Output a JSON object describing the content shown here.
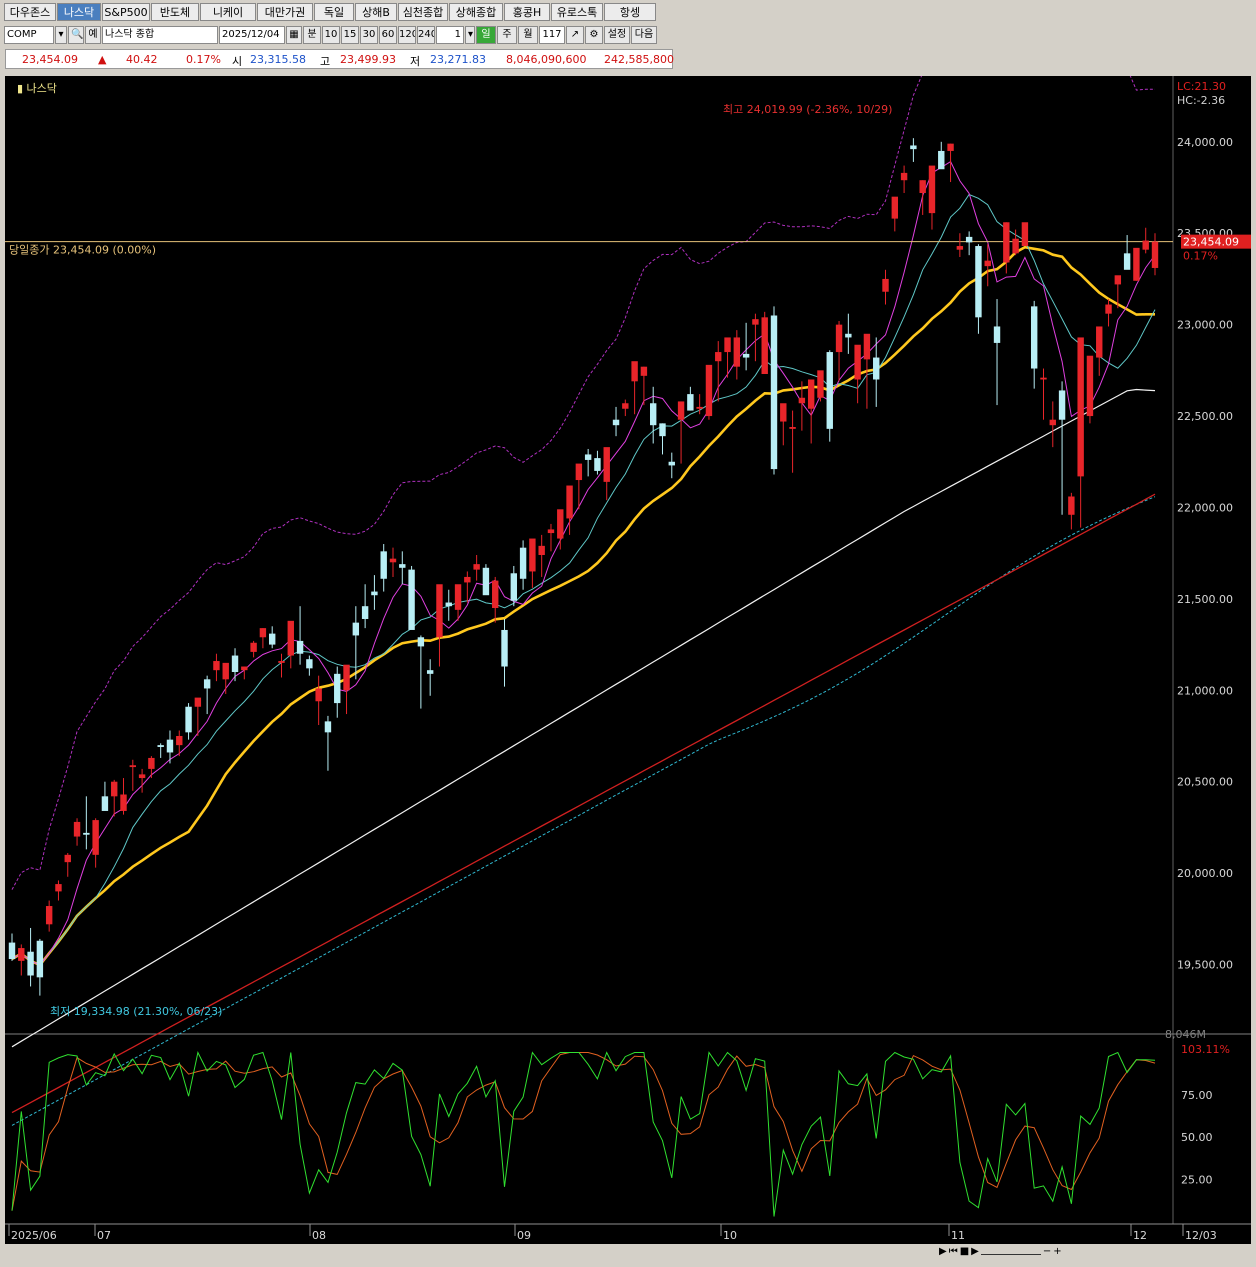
{
  "tabs": [
    "다우존스",
    "나스닥",
    "S&P500",
    "반도체",
    "니케이",
    "대만가권",
    "독일",
    "상해B",
    "심천종합",
    "상해종합",
    "홍콩H",
    "유로스톡",
    "항셍"
  ],
  "active_tab": "나스닥",
  "toolbar": {
    "code": "COMP",
    "name": "나스닥 종합",
    "date": "2025/12/04",
    "label_ye": "예",
    "minute": "분",
    "intervals": [
      "10",
      "15",
      "30",
      "60",
      "120",
      "240"
    ],
    "unit_value": "1",
    "day": "일",
    "week": "주",
    "month": "월",
    "count": "117",
    "settings": "설정",
    "next": "다음"
  },
  "quote": {
    "last": "23,454.09",
    "arrow": "▲",
    "change": "40.42",
    "pct": "0.17%",
    "open_label": "시",
    "open": "23,315.58",
    "high_label": "고",
    "high": "23,499.93",
    "low_label": "저",
    "low": "23,271.83",
    "volume": "8,046,090,600",
    "amount": "242,585,800"
  },
  "colors": {
    "up": "#e8252a",
    "down": "#b8eef5",
    "ma5": "#e040e0",
    "ma10": "#5fc7c7",
    "ma20": "#ffc81e",
    "ma60": "#f0f0f0",
    "ma120": "#d02020",
    "bb": "#b030c0",
    "env": "#30b8d0",
    "fast": "#e06020",
    "slow": "#30e030"
  },
  "chart_data": {
    "type": "candlestick",
    "title": "나스닥",
    "period": "2025/06 - 2025/12",
    "y_ticks": [
      19500,
      20000,
      20500,
      21000,
      21500,
      22000,
      22500,
      23000,
      23500,
      24000
    ],
    "y_tick_labels": [
      "19,500.00",
      "20,000.00",
      "20,500.00",
      "21,000.00",
      "21,500.00",
      "22,000.00",
      "22,500.00",
      "23,000.00",
      "23,500.00",
      "24,000.00"
    ],
    "ylim": [
      19120,
      24360
    ],
    "x_labels": [
      "2025/06",
      "07",
      "08",
      "09",
      "10",
      "11",
      "12",
      "12/03"
    ],
    "ohlc": [
      [
        19620,
        19670,
        19520,
        19530
      ],
      [
        19520,
        19610,
        19440,
        19590
      ],
      [
        19570,
        19700,
        19380,
        19440
      ],
      [
        19630,
        19640,
        19330,
        19430
      ],
      [
        19720,
        19850,
        19680,
        19820
      ],
      [
        19900,
        19960,
        19850,
        19940
      ],
      [
        20060,
        20110,
        19980,
        20100
      ],
      [
        20200,
        20300,
        20150,
        20280
      ],
      [
        20220,
        20420,
        20130,
        20210
      ],
      [
        20100,
        20300,
        20030,
        20290
      ],
      [
        20420,
        20500,
        20350,
        20340
      ],
      [
        20420,
        20510,
        20310,
        20500
      ],
      [
        20340,
        20520,
        20320,
        20430
      ],
      [
        20580,
        20620,
        20450,
        20590
      ],
      [
        20520,
        20570,
        20440,
        20540
      ],
      [
        20570,
        20640,
        20520,
        20630
      ],
      [
        20700,
        20710,
        20630,
        20690
      ],
      [
        20730,
        20780,
        20600,
        20660
      ],
      [
        20700,
        20780,
        20640,
        20750
      ],
      [
        20910,
        20930,
        20730,
        20770
      ],
      [
        20910,
        20940,
        20750,
        20960
      ],
      [
        21060,
        21080,
        20870,
        21010
      ],
      [
        21110,
        21200,
        21050,
        21160
      ],
      [
        21060,
        21130,
        20980,
        21150
      ],
      [
        21190,
        21230,
        21050,
        21100
      ],
      [
        21110,
        21130,
        21060,
        21130
      ],
      [
        21210,
        21270,
        21180,
        21260
      ],
      [
        21290,
        21340,
        21230,
        21340
      ],
      [
        21310,
        21350,
        21230,
        21250
      ],
      [
        21150,
        21200,
        21070,
        21160
      ],
      [
        21190,
        21300,
        21120,
        21380
      ],
      [
        21270,
        21460,
        21140,
        21200
      ],
      [
        21170,
        21190,
        21080,
        21120
      ],
      [
        20940,
        21080,
        20810,
        21010
      ],
      [
        20830,
        20860,
        20560,
        20770
      ],
      [
        21090,
        21130,
        20850,
        20930
      ],
      [
        21000,
        21120,
        20870,
        21140
      ],
      [
        21370,
        21460,
        21060,
        21300
      ],
      [
        21460,
        21580,
        21340,
        21390
      ],
      [
        21540,
        21630,
        21440,
        21520
      ],
      [
        21760,
        21800,
        21540,
        21610
      ],
      [
        21700,
        21780,
        21620,
        21720
      ],
      [
        21690,
        21760,
        21580,
        21670
      ],
      [
        21660,
        21680,
        21490,
        21330
      ],
      [
        21290,
        21300,
        20900,
        21240
      ],
      [
        21110,
        21170,
        20970,
        21090
      ],
      [
        21290,
        21310,
        21130,
        21580
      ],
      [
        21480,
        21550,
        21380,
        21460
      ],
      [
        21440,
        21520,
        21380,
        21580
      ],
      [
        21590,
        21650,
        21480,
        21620
      ],
      [
        21660,
        21740,
        21600,
        21690
      ],
      [
        21670,
        21690,
        21540,
        21520
      ],
      [
        21450,
        21620,
        21370,
        21600
      ],
      [
        21330,
        21390,
        21020,
        21130
      ],
      [
        21640,
        21680,
        21460,
        21490
      ],
      [
        21780,
        21820,
        21550,
        21610
      ],
      [
        21650,
        21690,
        21560,
        21830
      ],
      [
        21740,
        21850,
        21620,
        21790
      ],
      [
        21860,
        21910,
        21760,
        21880
      ],
      [
        21830,
        21950,
        21770,
        21990
      ],
      [
        21940,
        22000,
        21850,
        22120
      ],
      [
        22150,
        22190,
        21990,
        22240
      ],
      [
        22290,
        22320,
        22170,
        22260
      ],
      [
        22270,
        22310,
        22180,
        22200
      ],
      [
        22140,
        22170,
        22040,
        22330
      ],
      [
        22480,
        22550,
        22390,
        22450
      ],
      [
        22540,
        22590,
        22500,
        22570
      ],
      [
        22690,
        22770,
        22510,
        22800
      ],
      [
        22720,
        22770,
        22560,
        22770
      ],
      [
        22570,
        22660,
        22350,
        22450
      ],
      [
        22460,
        22460,
        22290,
        22390
      ],
      [
        22250,
        22300,
        22160,
        22230
      ],
      [
        22480,
        22510,
        22240,
        22580
      ],
      [
        22620,
        22660,
        22530,
        22530
      ],
      [
        22540,
        22620,
        22510,
        22550
      ],
      [
        22500,
        22600,
        22480,
        22780
      ],
      [
        22800,
        22910,
        22580,
        22850
      ],
      [
        22850,
        22910,
        22710,
        22930
      ],
      [
        22770,
        22970,
        22700,
        22930
      ],
      [
        22840,
        23010,
        22750,
        22820
      ],
      [
        23000,
        23060,
        22800,
        23030
      ],
      [
        22730,
        23070,
        22770,
        23040
      ],
      [
        23050,
        23100,
        22180,
        22210
      ],
      [
        22470,
        22510,
        22340,
        22570
      ],
      [
        22430,
        22530,
        22190,
        22440
      ],
      [
        22570,
        22690,
        22420,
        22600
      ],
      [
        22540,
        22600,
        22350,
        22700
      ],
      [
        22600,
        22720,
        22580,
        22750
      ],
      [
        22850,
        22860,
        22360,
        22430
      ],
      [
        22850,
        23020,
        22690,
        23000
      ],
      [
        22950,
        23060,
        22840,
        22930
      ],
      [
        22700,
        22830,
        22570,
        22890
      ],
      [
        22810,
        22860,
        22540,
        22950
      ],
      [
        22820,
        22930,
        22550,
        22700
      ],
      [
        23180,
        23300,
        23110,
        23250
      ],
      [
        23580,
        23640,
        23510,
        23700
      ],
      [
        23790,
        23870,
        23720,
        23830
      ],
      [
        23980,
        24020,
        23890,
        23960
      ],
      [
        23720,
        23790,
        23600,
        23790
      ],
      [
        23610,
        23700,
        23520,
        23870
      ],
      [
        23950,
        24000,
        23870,
        23850
      ],
      [
        23950,
        23990,
        23780,
        23990
      ],
      [
        23410,
        23500,
        23370,
        23430
      ],
      [
        23480,
        23510,
        23380,
        23450
      ],
      [
        23430,
        23440,
        22950,
        23040
      ],
      [
        23320,
        23440,
        23210,
        23350
      ],
      [
        22990,
        23140,
        22560,
        22900
      ],
      [
        23340,
        23560,
        23280,
        23560
      ],
      [
        23390,
        23520,
        23380,
        23470
      ],
      [
        23430,
        23530,
        23430,
        23560
      ],
      [
        23100,
        23130,
        22650,
        22760
      ],
      [
        22700,
        22760,
        22480,
        22710
      ],
      [
        22450,
        22580,
        22330,
        22480
      ],
      [
        22640,
        22690,
        21960,
        22480
      ],
      [
        21960,
        22080,
        21880,
        22060
      ],
      [
        22170,
        22240,
        21890,
        22930
      ],
      [
        22500,
        22750,
        22460,
        22830
      ],
      [
        22820,
        22930,
        22720,
        22990
      ],
      [
        23060,
        23140,
        22990,
        23110
      ],
      [
        23220,
        23250,
        23090,
        23270
      ],
      [
        23390,
        23490,
        23320,
        23300
      ],
      [
        23240,
        23400,
        23240,
        23420
      ],
      [
        23410,
        23530,
        23390,
        23460
      ],
      [
        23310,
        23500,
        23270,
        23454
      ]
    ],
    "annotations": {
      "high": "최고 24,019.99 (-2.36%, 10/29)",
      "low": "최저 19,334.98 (21.30%, 06/23)",
      "close_line": "당일종가 23,454.09 (0.00%)",
      "last_value": "23,454.09",
      "last_pct": "0.17%",
      "lc": "LC:21.30",
      "hc": "HC:-2.36"
    },
    "stoch": {
      "y_ticks": [
        25,
        50,
        75
      ],
      "y_tick_labels": [
        "25.00",
        "50.00",
        "75.00"
      ],
      "top_label": "103.11%",
      "vol_label": "8,046M"
    }
  }
}
